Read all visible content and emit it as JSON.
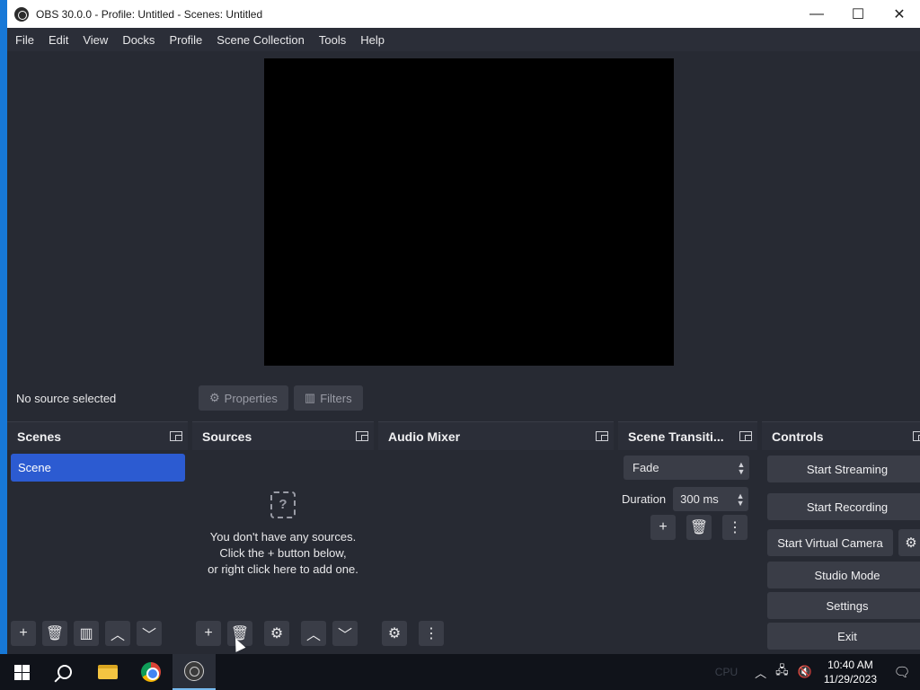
{
  "window": {
    "title": "OBS 30.0.0 - Profile: Untitled - Scenes: Untitled",
    "minimize": "—",
    "maximize": "☐",
    "close": "✕"
  },
  "menu": [
    "File",
    "Edit",
    "View",
    "Docks",
    "Profile",
    "Scene Collection",
    "Tools",
    "Help"
  ],
  "source_bar": {
    "status": "No source selected",
    "properties_label": "Properties",
    "filters_label": "Filters"
  },
  "scenes": {
    "title": "Scenes",
    "items": [
      "Scene"
    ]
  },
  "sources": {
    "title": "Sources",
    "empty_line1": "You don't have any sources.",
    "empty_line2": "Click the + button below,",
    "empty_line3": "or right click here to add one."
  },
  "audio_mixer": {
    "title": "Audio Mixer"
  },
  "transitions": {
    "title": "Scene Transiti...",
    "selected": "Fade",
    "duration_label": "Duration",
    "duration_value": "300 ms"
  },
  "controls": {
    "title": "Controls",
    "start_streaming": "Start Streaming",
    "start_recording": "Start Recording",
    "start_virtual_camera": "Start Virtual Camera",
    "studio_mode": "Studio Mode",
    "settings": "Settings",
    "exit": "Exit"
  },
  "taskbar": {
    "tray_faint": "CPU",
    "time": "10:40 AM",
    "date": "11/29/2023"
  },
  "colors": {
    "accent": "#2c5bd1",
    "dock_bg": "#2b2e38",
    "panel_bg": "#272a33",
    "button_bg": "#3a3d47"
  }
}
